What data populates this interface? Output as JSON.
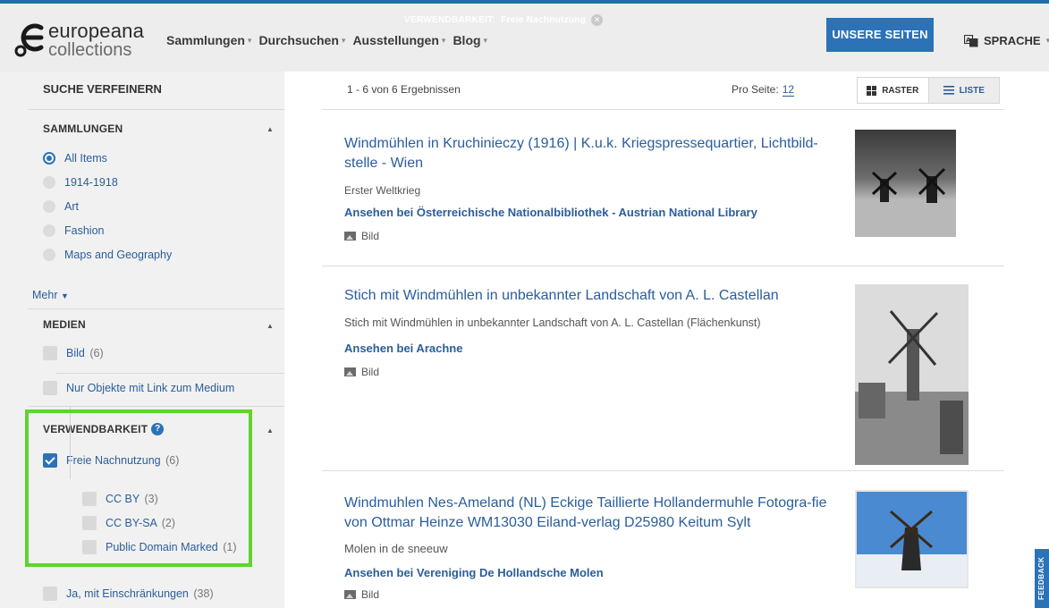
{
  "header": {
    "logo_word": "europeana",
    "logo_sub": "collections",
    "nav": [
      {
        "label": "Sammlungen"
      },
      {
        "label": "Durchsuchen"
      },
      {
        "label": "Ausstellungen"
      },
      {
        "label": "Blog"
      }
    ],
    "active_filter_key": "VERWENDBARKEIT:",
    "active_filter_value": "Freie Nachnutzung",
    "unsere_seiten": "UNSERE SEITEN",
    "sprache": "SPRACHE"
  },
  "sidebar": {
    "title": "SUCHE VERFEINERN",
    "sammlungen": {
      "heading": "SAMMLUNGEN",
      "options": [
        {
          "label": "All Items",
          "selected": true
        },
        {
          "label": "1914-1918",
          "selected": false
        },
        {
          "label": "Art",
          "selected": false
        },
        {
          "label": "Fashion",
          "selected": false
        },
        {
          "label": "Maps and Geography",
          "selected": false
        }
      ],
      "more": "Mehr"
    },
    "medien": {
      "heading": "MEDIEN",
      "bild": "Bild",
      "bild_count": "(6)",
      "link_only": "Nur Objekte mit Link zum Medium"
    },
    "verwendbarkeit": {
      "heading": "VERWENDBARKEIT",
      "freie": "Freie Nachnutzung",
      "freie_count": "(6)",
      "sub": [
        {
          "label": "CC BY",
          "count": "(3)"
        },
        {
          "label": "CC BY-SA",
          "count": "(2)"
        },
        {
          "label": "Public Domain Marked",
          "count": "(1)"
        }
      ],
      "ja": "Ja, mit Einschränkungen",
      "ja_count": "(38)"
    }
  },
  "results": {
    "count": "1 - 6 von 6 Ergebnissen",
    "per_page_label": "Pro Seite:",
    "per_page_value": "12",
    "raster": "RASTER",
    "liste": "LISTE",
    "items": [
      {
        "title": "Windmühlen in Kruchinieczy (1916) | K.u.k. Kriegspressequartier, Lichtbild-stelle - Wien",
        "desc": "Erster Weltkrieg",
        "provider": "Ansehen bei Österreichische Nationalbibliothek - Austrian National Library",
        "type": "Bild"
      },
      {
        "title": "Stich mit Windmühlen in unbekannter Landschaft von A. L. Castellan",
        "desc": "Stich mit Windmühlen in unbekannter Landschaft von A. L. Castellan (Flächenkunst)",
        "provider": "Ansehen bei Arachne",
        "type": "Bild"
      },
      {
        "title": "Windmuhlen Nes-Ameland (NL) Eckige Taillierte Hollandermuhle Fotogra-fie von Ottmar Heinze WM13030 Eiland-verlag D25980 Keitum Sylt",
        "desc": "Molen in de sneeuw",
        "provider": "Ansehen bei Vereniging De Hollandsche Molen",
        "type": "Bild"
      }
    ]
  },
  "feedback": "FEEDBACK",
  "colors": {
    "accent": "#2c72b7",
    "link": "#2a5d9c",
    "highlight": "#5fd32f",
    "sidebar_bg": "#f1f1f1",
    "header_bg": "#ededed"
  }
}
